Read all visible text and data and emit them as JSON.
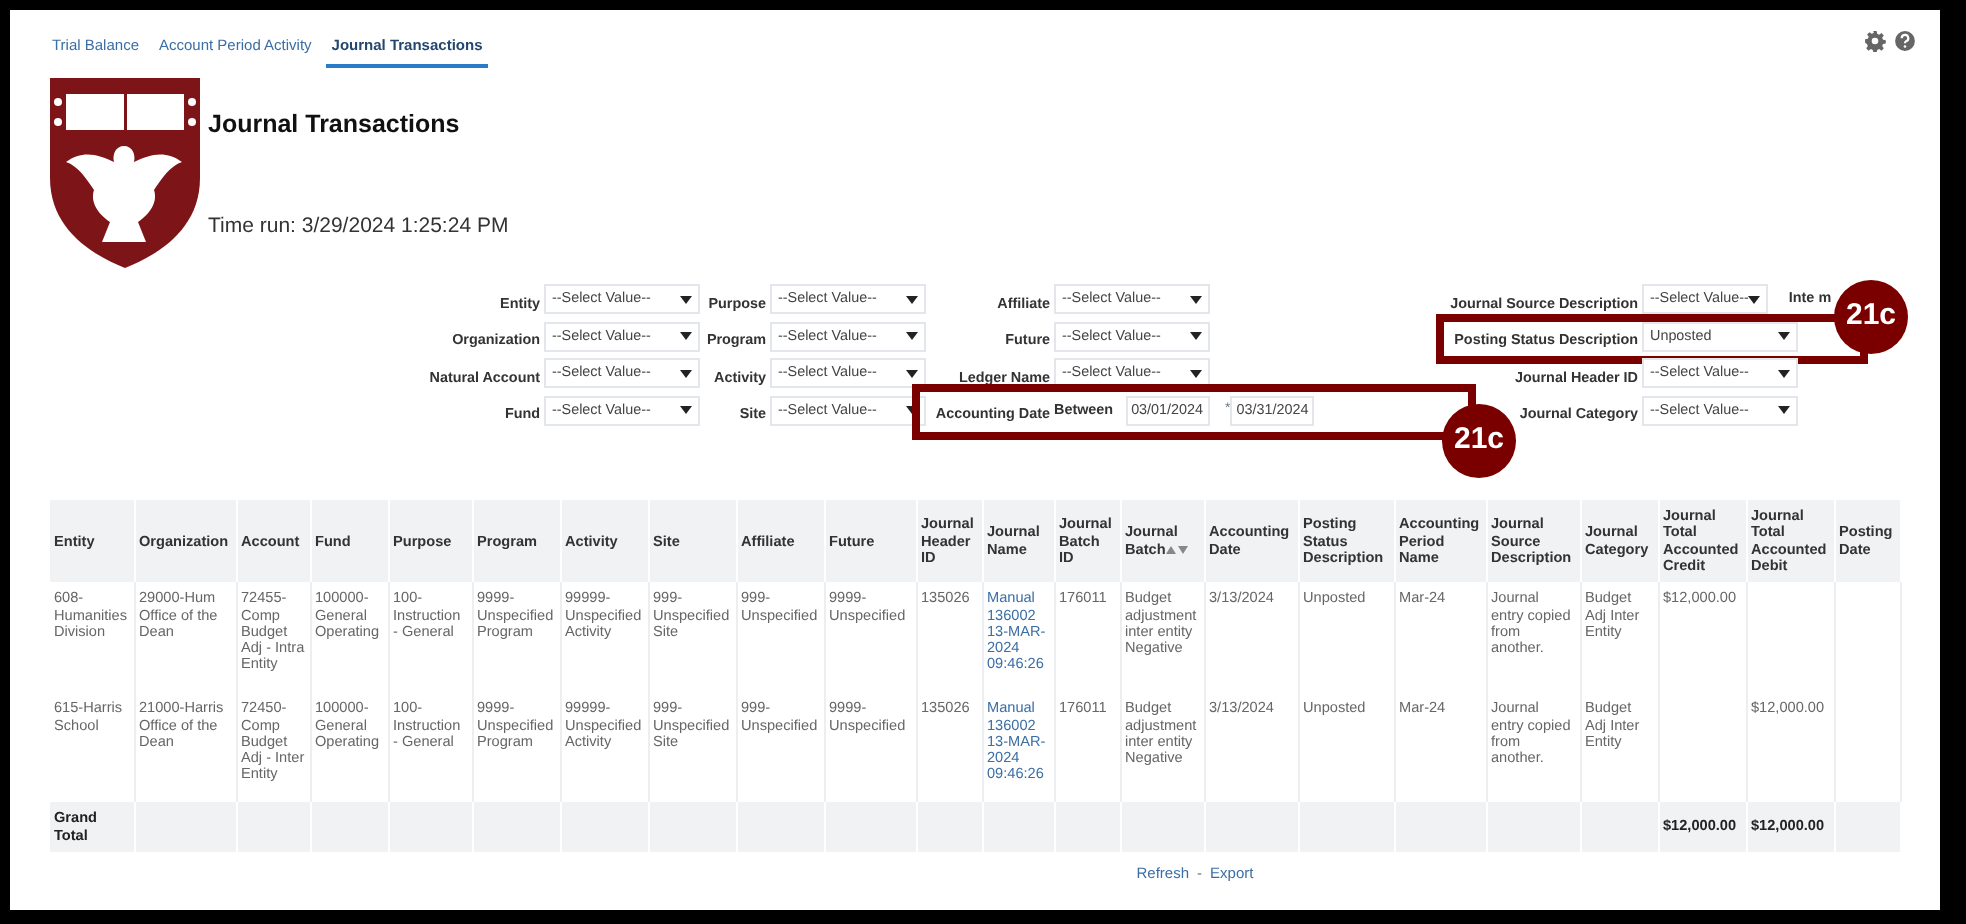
{
  "tabs": [
    {
      "label": "Trial Balance",
      "selected": false
    },
    {
      "label": "Account Period Activity",
      "selected": false
    },
    {
      "label": "Journal Transactions",
      "selected": true
    }
  ],
  "report": {
    "title": "Journal Transactions",
    "time_run": "Time run: 3/29/2024 1:25:24 PM"
  },
  "filters": [
    [
      {
        "kind": "select",
        "label": "Entity",
        "value": "--Select Value--"
      },
      {
        "kind": "select",
        "label": "Organization",
        "value": "--Select Value--"
      },
      {
        "kind": "select",
        "label": "Natural Account",
        "value": "--Select Value--"
      },
      {
        "kind": "select",
        "label": "Fund",
        "value": "--Select Value--"
      }
    ],
    [
      {
        "kind": "select",
        "label": "Purpose",
        "value": "--Select Value--"
      },
      {
        "kind": "select",
        "label": "Program",
        "value": "--Select Value--"
      },
      {
        "kind": "select",
        "label": "Activity",
        "value": "--Select Value--"
      },
      {
        "kind": "select",
        "label": "Site",
        "value": "--Select Value--"
      }
    ],
    [
      {
        "kind": "select",
        "label": "Affiliate",
        "value": "--Select Value--"
      },
      {
        "kind": "select",
        "label": "Future",
        "value": "--Select Value--"
      },
      {
        "kind": "select",
        "label": "Ledger Name",
        "value": "--Select Value--"
      },
      {
        "kind": "date_range",
        "label": "Accounting Date",
        "connector": "Between",
        "from": "03/01/2024",
        "required": "*",
        "to": "03/31/2024",
        "callout": "21c"
      }
    ],
    [
      {
        "kind": "select",
        "label": "Journal Source Description",
        "value": "--Select Value--",
        "extra_label": [
          "Inte",
          "m"
        ]
      },
      {
        "kind": "select",
        "label": "Posting Status Description",
        "value": "Unposted",
        "callout": "21c"
      },
      {
        "kind": "select",
        "label": "Journal Header ID",
        "value": "--Select Value--"
      },
      {
        "kind": "select",
        "label": "Journal Category",
        "value": "--Select Value--"
      }
    ]
  ],
  "table": {
    "columns": [
      {
        "label": "Entity",
        "kind": "text"
      },
      {
        "label": "Organization",
        "kind": "text"
      },
      {
        "label": "Account",
        "kind": "text"
      },
      {
        "label": "Fund",
        "kind": "text"
      },
      {
        "label": "Purpose",
        "kind": "text"
      },
      {
        "label": "Program",
        "kind": "text"
      },
      {
        "label": "Activity",
        "kind": "text"
      },
      {
        "label": "Site",
        "kind": "text"
      },
      {
        "label": "Affiliate",
        "kind": "text"
      },
      {
        "label": "Future",
        "kind": "text"
      },
      {
        "label": "Journal Header ID",
        "kind": "text"
      },
      {
        "label": "Journal Name",
        "kind": "link"
      },
      {
        "label": "Journal Batch ID",
        "kind": "text"
      },
      {
        "label": "Journal Batch",
        "kind": "sortable"
      },
      {
        "label": "Accounting Date",
        "kind": "text"
      },
      {
        "label": "Posting Status Description",
        "kind": "text"
      },
      {
        "label": "Accounting Period Name",
        "kind": "text"
      },
      {
        "label": "Journal Source Description",
        "kind": "text"
      },
      {
        "label": "Journal Category",
        "kind": "text"
      },
      {
        "label": "Journal Total Accounted Credit",
        "kind": "text"
      },
      {
        "label": "Journal Total Accounted Debit",
        "kind": "text"
      },
      {
        "label": "Posting Date",
        "kind": "text"
      }
    ],
    "rows": [
      {
        "entity": "608-Humanities Division",
        "organization": "29000-Hum Office of the Dean",
        "account": "72455-Comp Budget Adj - Intra Entity",
        "fund": "100000-General Operating",
        "purpose": "100-Instruction - General",
        "program": "9999-Unspecified Program",
        "activity": "99999-Unspecified Activity",
        "site": "999-Unspecified Site",
        "affiliate": "999-Unspecified",
        "future": "9999-Unspecified",
        "journal_header_id": "135026",
        "journal_name": "Manual 136002 13-MAR-2024 09:46:26",
        "journal_batch_id": "176011",
        "journal_batch": "Budget adjustment inter entity Negative",
        "accounting_date": "3/13/2024",
        "posting_status_description": "Unposted",
        "accounting_period_name": "Mar-24",
        "journal_source_description": "Journal entry copied from another.",
        "journal_category": "Budget Adj Inter Entity",
        "journal_total_accounted_credit": "$12,000.00"
      },
      {
        "entity": "615-Harris School",
        "organization": "21000-Harris Office of the Dean",
        "account": "72450-Comp Budget Adj - Inter Entity",
        "fund": "100000-General Operating",
        "purpose": "100-Instruction - General",
        "program": "9999-Unspecified Program",
        "activity": "99999-Unspecified Activity",
        "site": "999-Unspecified Site",
        "affiliate": "999-Unspecified",
        "future": "9999-Unspecified",
        "journal_header_id": "135026",
        "journal_name": "Manual 136002 13-MAR-2024 09:46:26",
        "journal_batch_id": "176011",
        "journal_batch": "Budget adjustment inter entity Negative",
        "accounting_date": "3/13/2024",
        "posting_status_description": "Unposted",
        "accounting_period_name": "Mar-24",
        "journal_source_description": "Journal entry copied from another.",
        "journal_category": "Budget Adj Inter Entity",
        "journal_total_accounted_debit": "$12,000.00"
      }
    ],
    "total": {
      "entity": "Grand Total",
      "journal_total_accounted_credit": "$12,000.00",
      "journal_total_accounted_debit": "$12,000.00"
    }
  },
  "footer": {
    "links": [
      "Refresh",
      "Export"
    ],
    "separator": "-"
  }
}
